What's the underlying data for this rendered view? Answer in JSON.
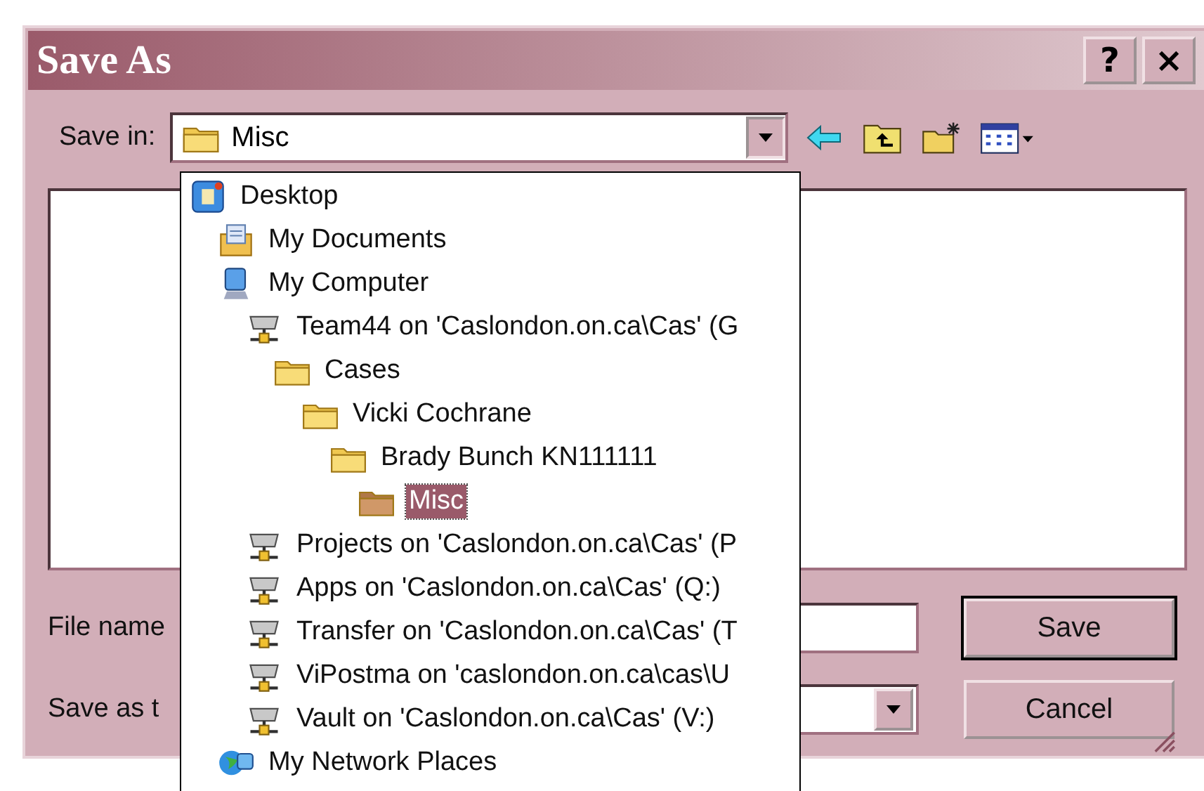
{
  "window": {
    "title": "Save As",
    "title_buttons": [
      "?",
      "×"
    ]
  },
  "save_in": {
    "label": "Save in:",
    "value": "Misc",
    "expanded": true
  },
  "location_tree": [
    {
      "label": "Desktop",
      "kind": "desktop",
      "selected": false,
      "children": [
        {
          "label": "My Documents",
          "kind": "documents",
          "selected": false
        },
        {
          "label": "My Computer",
          "kind": "computer",
          "selected": false,
          "children": [
            {
              "label": "Team44 on 'Caslondon.on.ca\\Cas' (G",
              "kind": "drive",
              "selected": false,
              "children": [
                {
                  "label": "Cases",
                  "kind": "folder",
                  "selected": false,
                  "children": [
                    {
                      "label": "Vicki Cochrane",
                      "kind": "folder",
                      "selected": false,
                      "children": [
                        {
                          "label": "Brady Bunch KN111111",
                          "kind": "folder",
                          "selected": false,
                          "children": [
                            {
                              "label": "Misc",
                              "kind": "folder",
                              "selected": true
                            }
                          ]
                        }
                      ]
                    }
                  ]
                }
              ]
            },
            {
              "label": "Projects on 'Caslondon.on.ca\\Cas' (P",
              "kind": "drive",
              "selected": false
            },
            {
              "label": "Apps on 'Caslondon.on.ca\\Cas' (Q:)",
              "kind": "drive",
              "selected": false
            },
            {
              "label": "Transfer on 'Caslondon.on.ca\\Cas' (T",
              "kind": "drive",
              "selected": false
            },
            {
              "label": "ViPostma on 'caslondon.on.ca\\cas\\U",
              "kind": "drive",
              "selected": false
            },
            {
              "label": "Vault on 'Caslondon.on.ca\\Cas' (V:)",
              "kind": "drive",
              "selected": false
            }
          ]
        },
        {
          "label": "My Network Places",
          "kind": "network",
          "selected": false
        }
      ]
    }
  ],
  "file_name": {
    "label": "File name"
  },
  "save_as_type": {
    "label": "Save as t"
  },
  "buttons": [
    "Save",
    "Cancel"
  ]
}
